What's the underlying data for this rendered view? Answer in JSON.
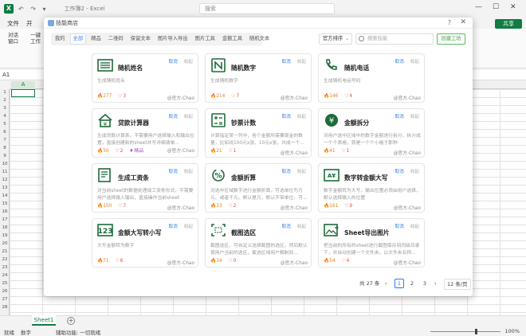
{
  "window": {
    "title": "工作簿2  -  Excel",
    "search_placeholder": "搜索",
    "app_letter": "X",
    "quick_access": "↶ ↷ ▾"
  },
  "menu": {
    "file": "文件",
    "home": "开"
  },
  "share_label": "共享",
  "ribbon": {
    "dialog": "对话\n窗口",
    "onekey": "一键\n工作"
  },
  "namebox": "A1",
  "column_a": "A",
  "rows": [
    "1",
    "2",
    "3",
    "4",
    "5",
    "6",
    "7",
    "8",
    "9",
    "10",
    "11",
    "12",
    "13",
    "14",
    "15",
    "16",
    "17",
    "18",
    "19",
    "20",
    "21",
    "22",
    "23",
    "24",
    "25",
    "26",
    "27",
    "28"
  ],
  "sheet_tab": "Sheet1",
  "status": {
    "ready": "就绪",
    "numeric": "数字",
    "accessibility": "辅助功能: 一切就绪",
    "zoom": "100%"
  },
  "dialog": {
    "title": "技能商店",
    "help": "?",
    "close": "✕",
    "filters": [
      {
        "label": "我的",
        "active": false
      },
      {
        "label": "全部",
        "active": true
      },
      {
        "label": "精品",
        "active": false
      },
      {
        "label": "二维码",
        "active": false
      },
      {
        "label": "保留文本",
        "active": false
      },
      {
        "label": "图片导入导出",
        "active": false
      },
      {
        "label": "图片工具",
        "active": false
      },
      {
        "label": "金额工具",
        "active": false
      },
      {
        "label": "随机文本",
        "active": false
      }
    ],
    "sort_label": "官方排序",
    "search_placeholder": "搜索技能",
    "create_label": "创建工坊",
    "cancel_label": "取消",
    "fav_label": "收起",
    "cards": [
      {
        "title": "随机姓名",
        "desc": "生成随机姓名",
        "hot": "277",
        "likes": "3",
        "author": "@官方-Chao",
        "icon": "list-icon",
        "premium": ""
      },
      {
        "title": "随机数字",
        "desc": "生成随机数字",
        "hot": "214",
        "likes": "7",
        "author": "@官方-Chao",
        "icon": "n-box-icon",
        "premium": ""
      },
      {
        "title": "随机电话",
        "desc": "生成随机电话号码",
        "hot": "146",
        "likes": "4",
        "author": "@官方-Chao",
        "icon": "phone-icon",
        "premium": ""
      },
      {
        "title": "贷款计算器",
        "desc": "生成贷款计算表，不需要用户选择输入和输出位置，直接创建新的sheet并写详细清单...",
        "hot": "50",
        "likes": "2",
        "author": "@官方-Chao",
        "icon": "house-calc-icon",
        "premium": "精品"
      },
      {
        "title": "钞票计数",
        "desc": "计算指定某一列中，各个金额所需要现金的数量，比如说100元x张、10元x张，共成一个...",
        "hot": "21",
        "likes": "1",
        "author": "@官方-Chao",
        "icon": "calculator-icon",
        "premium": ""
      },
      {
        "title": "金额拆分",
        "desc": "对用户选中区域中的数字金额进行拆分，拆分成一个个表格，就是一个个小格子那种",
        "hot": "41",
        "likes": "1",
        "author": "@官方-Chao",
        "icon": "yen-icon",
        "premium": ""
      },
      {
        "title": "生成工资条",
        "desc": "对当前sheet的数据处理成工资条形式，不需要用户选择输入输出，直接操作当前sheet",
        "hot": "150",
        "likes": "7",
        "author": "@官方-Chao",
        "icon": "payslip-icon",
        "premium": ""
      },
      {
        "title": "金额折算",
        "desc": "对选中区域数字进行金额折算，可选单位为万元、或者千元，默认是万，默认不带单位，可...",
        "hot": "33",
        "likes": "2",
        "author": "@官方-Chao",
        "icon": "percent-icon",
        "premium": ""
      },
      {
        "title": "数字转金额大写",
        "desc": "数字金额转为大写，输出位置必须由用户选择，默认选择输入的位置",
        "hot": "161",
        "likes": "9",
        "author": "@官方-Chao",
        "icon": "amount-case-icon",
        "premium": ""
      },
      {
        "title": "金额大写转小写",
        "desc": "大写金额转为数字",
        "hot": "71",
        "likes": "6",
        "author": "@官方-Chao",
        "icon": "digits-123-icon",
        "premium": ""
      },
      {
        "title": "截图选区",
        "desc": "截图选区，可自定义选择截图的选区，然后默认使用户当前的选区，截选区域用户解制到...",
        "hot": "34",
        "likes": "0",
        "author": "@官方-Chao",
        "icon": "crop-select-icon",
        "premium": ""
      },
      {
        "title": "Sheet导出图片",
        "desc": "把当前的所有的sheet进行截图保存到同级目录下，并自动创建一个文件夹，以文件夹名称...",
        "hot": "54",
        "likes": "4",
        "author": "@官方-Chao",
        "icon": "image-export-icon",
        "premium": ""
      }
    ],
    "pager": {
      "total": "共 27 条",
      "prev": "‹",
      "pages": [
        {
          "label": "1",
          "active": true
        },
        {
          "label": "2",
          "active": false
        },
        {
          "label": "3",
          "active": false
        }
      ],
      "next": "›",
      "size": "12 条/页"
    }
  },
  "colors": {
    "excel_green": "#107c41",
    "accent_blue": "#2b7de9",
    "icon_green": "#1d6b3a"
  }
}
